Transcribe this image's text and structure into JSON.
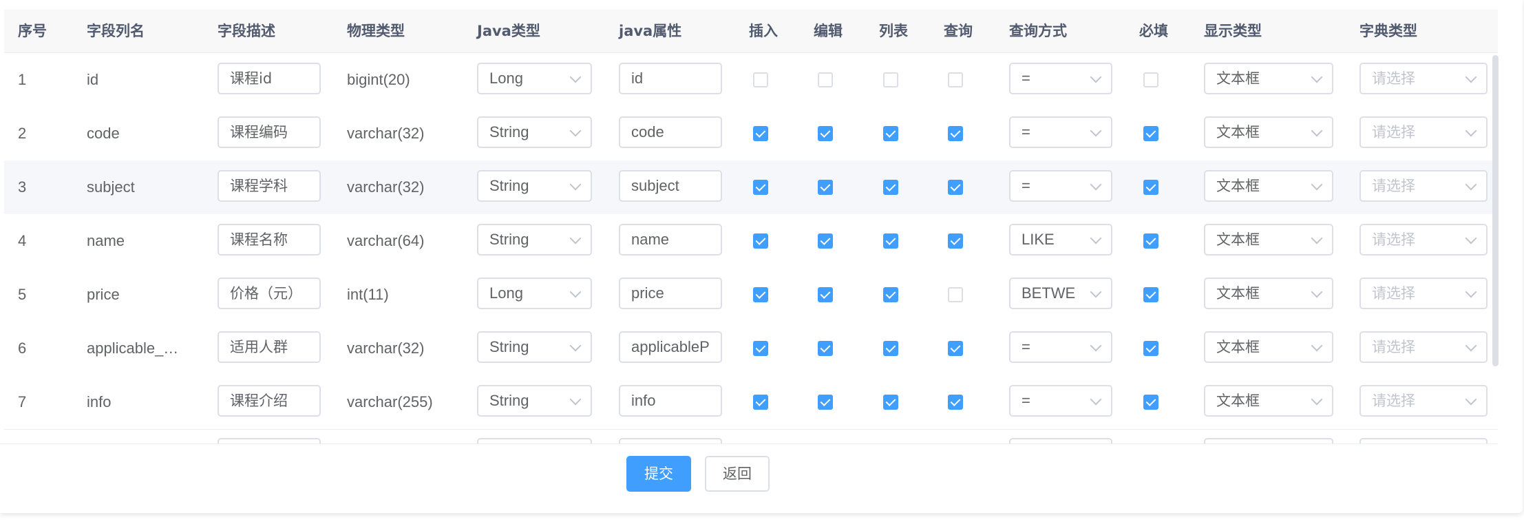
{
  "headers": {
    "index": "序号",
    "column_name": "字段列名",
    "description": "字段描述",
    "physical_type": "物理类型",
    "java_type": "Java类型",
    "java_field": "java属性",
    "insert": "插入",
    "edit": "编辑",
    "list": "列表",
    "query": "查询",
    "query_mode": "查询方式",
    "required": "必填",
    "display_type": "显示类型",
    "dict_type": "字典类型"
  },
  "rows": [
    {
      "index": "1",
      "column_name": "id",
      "description": "课程id",
      "physical_type": "bigint(20)",
      "java_type": "Long",
      "java_field": "id",
      "insert": false,
      "edit": false,
      "list": false,
      "query": false,
      "query_mode": "=",
      "required": false,
      "display_type": "文本框",
      "dict_placeholder": "请选择"
    },
    {
      "index": "2",
      "column_name": "code",
      "description": "课程编码",
      "physical_type": "varchar(32)",
      "java_type": "String",
      "java_field": "code",
      "insert": true,
      "edit": true,
      "list": true,
      "query": true,
      "query_mode": "=",
      "required": true,
      "display_type": "文本框",
      "dict_placeholder": "请选择"
    },
    {
      "index": "3",
      "column_name": "subject",
      "description": "课程学科",
      "physical_type": "varchar(32)",
      "java_type": "String",
      "java_field": "subject",
      "insert": true,
      "edit": true,
      "list": true,
      "query": true,
      "query_mode": "=",
      "required": true,
      "display_type": "文本框",
      "dict_placeholder": "请选择"
    },
    {
      "index": "4",
      "column_name": "name",
      "description": "课程名称",
      "physical_type": "varchar(64)",
      "java_type": "String",
      "java_field": "name",
      "insert": true,
      "edit": true,
      "list": true,
      "query": true,
      "query_mode": "LIKE",
      "required": true,
      "display_type": "文本框",
      "dict_placeholder": "请选择"
    },
    {
      "index": "5",
      "column_name": "price",
      "description": "价格（元）",
      "physical_type": "int(11)",
      "java_type": "Long",
      "java_field": "price",
      "insert": true,
      "edit": true,
      "list": true,
      "query": false,
      "query_mode": "BETWE",
      "required": true,
      "display_type": "文本框",
      "dict_placeholder": "请选择"
    },
    {
      "index": "6",
      "column_name": "applicable_…",
      "description": "适用人群",
      "physical_type": "varchar(32)",
      "java_type": "String",
      "java_field": "applicableP",
      "insert": true,
      "edit": true,
      "list": true,
      "query": true,
      "query_mode": "=",
      "required": true,
      "display_type": "文本框",
      "dict_placeholder": "请选择"
    },
    {
      "index": "7",
      "column_name": "info",
      "description": "课程介绍",
      "physical_type": "varchar(255)",
      "java_type": "String",
      "java_field": "info",
      "insert": true,
      "edit": true,
      "list": true,
      "query": true,
      "query_mode": "=",
      "required": true,
      "display_type": "文本框",
      "dict_placeholder": "请选择"
    }
  ],
  "hover_row_index": 2,
  "buttons": {
    "submit": "提交",
    "back": "返回"
  },
  "colors": {
    "primary": "#409eff",
    "header_bg": "#f8f8f9",
    "hover_bg": "#f5f7fa",
    "border": "#dcdfe6"
  },
  "icons": {
    "select_arrow": "chevron-down-icon",
    "checkbox": "checkbox-icon"
  }
}
